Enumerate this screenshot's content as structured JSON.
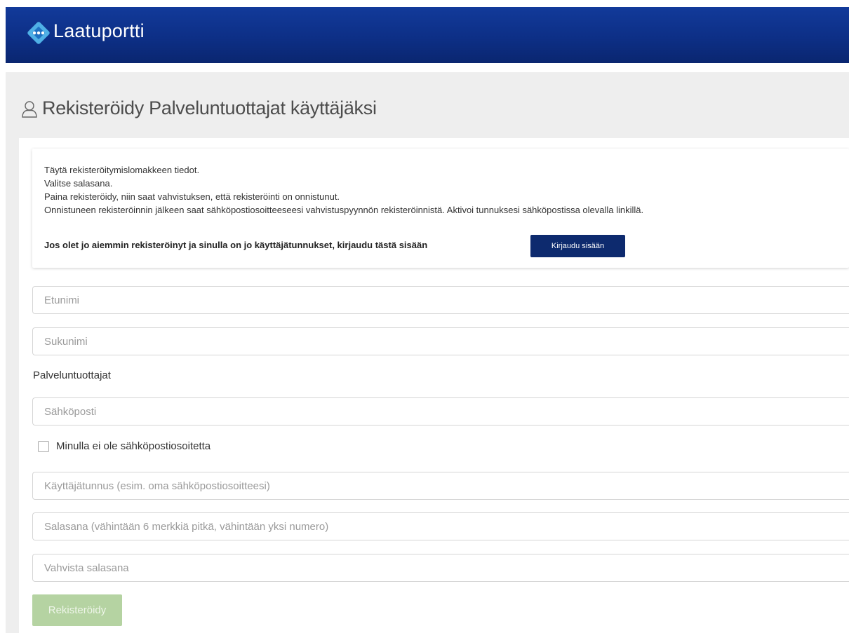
{
  "header": {
    "logo_icon": "diamond-dots-icon",
    "brand": "Laatuportti"
  },
  "page": {
    "title_icon": "user-icon",
    "title": "Rekisteröidy Palveluntuottajat käyttäjäksi"
  },
  "info": {
    "lines": [
      "Täytä rekisteröitymislomakkeen tiedot.",
      "Valitse salasana.",
      "Paina rekisteröidy, niin saat vahvistuksen, että rekisteröinti on onnistunut.",
      "Onnistuneen rekisteröinnin jälkeen saat sähköpostiosoitteeseesi vahvistuspyynnön rekisteröinnistä. Aktivoi tunnuksesi sähköpostissa olevalla linkillä."
    ],
    "login_prompt": "Jos olet jo aiemmin rekisteröinyt ja sinulla on jo käyttäjätunnukset, kirjaudu tästä sisään",
    "login_button": "Kirjaudu sisään"
  },
  "form": {
    "first_name_placeholder": "Etunimi",
    "last_name_placeholder": "Sukunimi",
    "organization_label": "Palveluntuottajat",
    "email_placeholder": "Sähköposti",
    "no_email_label": "Minulla ei ole sähköpostiosoitetta",
    "username_placeholder": "Käyttäjätunnus (esim. oma sähköpostiosoitteesi)",
    "password_placeholder": "Salasana (vähintään 6 merkkiä pitkä, vähintään yksi numero)",
    "confirm_password_placeholder": "Vahvista salasana",
    "submit_label": "Rekisteröidy"
  },
  "colors": {
    "header_blue": "#0d2f86",
    "login_button": "#0d2a6e",
    "submit_disabled": "#b5d3a2",
    "band_gray": "#eeeeee"
  }
}
